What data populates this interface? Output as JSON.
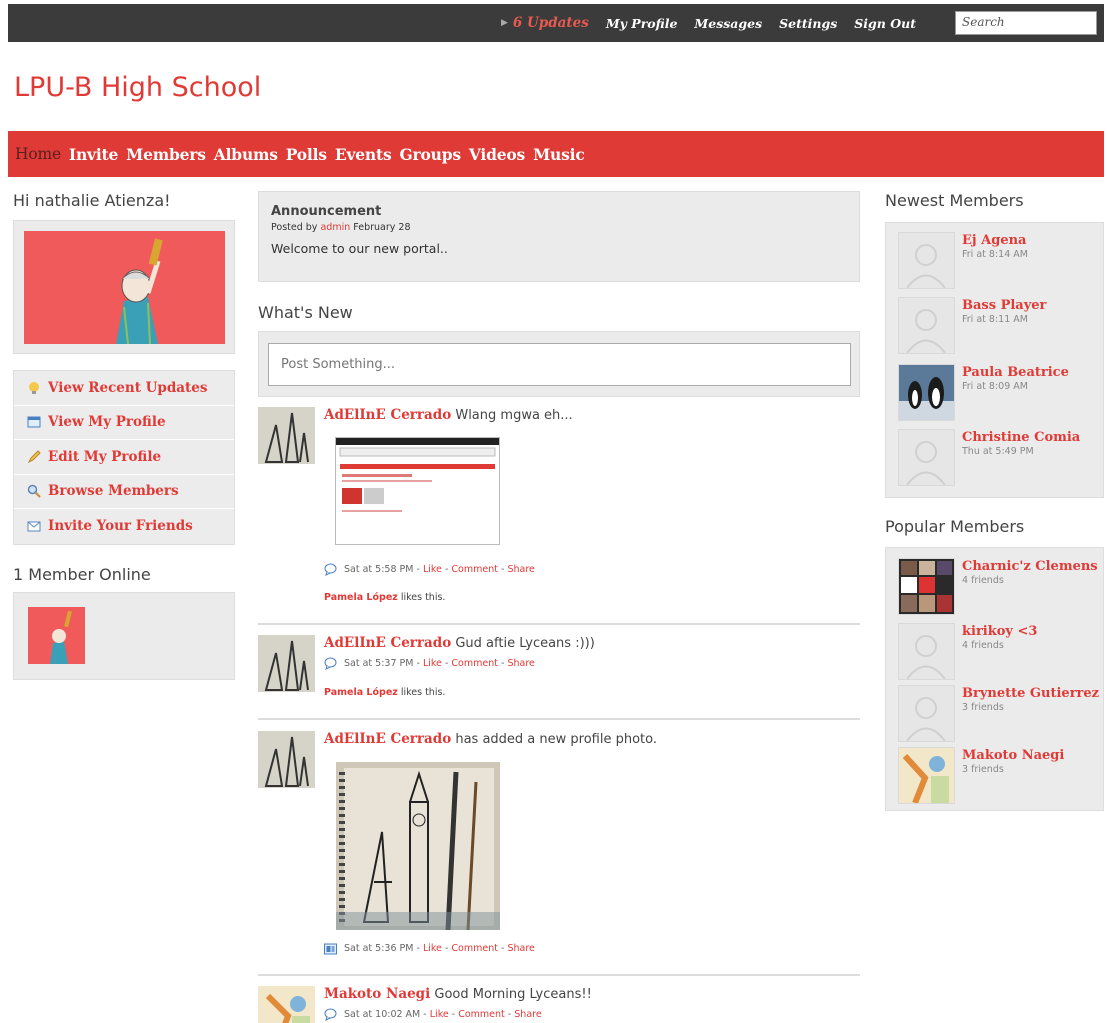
{
  "topbar": {
    "updates": "6 Updates",
    "links": [
      "My Profile",
      "Messages",
      "Settings",
      "Sign Out"
    ],
    "search_value": "Search"
  },
  "site_title": "LPU-B High School",
  "nav": [
    "Home",
    "Invite",
    "Members",
    "Albums",
    "Polls",
    "Events",
    "Groups",
    "Videos",
    "Music"
  ],
  "left": {
    "greeting": "Hi nathalie Atienza!",
    "quick_links": [
      {
        "label": "View Recent Updates",
        "icon": "lightbulb-icon"
      },
      {
        "label": "View My Profile",
        "icon": "profile-card-icon"
      },
      {
        "label": "Edit My Profile",
        "icon": "pencil-icon"
      },
      {
        "label": "Browse Members",
        "icon": "magnifier-icon"
      },
      {
        "label": "Invite Your Friends",
        "icon": "envelope-icon"
      }
    ],
    "online_title": "1 Member Online"
  },
  "announcement": {
    "title": "Announcement",
    "posted_by_prefix": "Posted by",
    "author": "admin",
    "date": "February 28",
    "message": "Welcome to our new portal.."
  },
  "whats_new": {
    "title": "What's New",
    "post_placeholder": "Post Something..."
  },
  "feed": [
    {
      "name": "AdElInE Cerrado",
      "text": "Wlang mgwa eh...",
      "time": "Sat at 5:58 PM",
      "likes_by": "Pamela López",
      "likes_suffix": "likes this."
    },
    {
      "name": "AdElInE Cerrado",
      "text": "Gud aftie Lyceans :)))",
      "time": "Sat at 5:37 PM",
      "likes_by": "Pamela López",
      "likes_suffix": "likes this."
    },
    {
      "name": "AdElInE Cerrado",
      "text": "has added a new profile photo.",
      "time": "Sat at 5:36 PM"
    },
    {
      "name": "Makoto Naegi",
      "text": "Good Morning Lyceans!!",
      "time": "Sat at 10:02 AM"
    }
  ],
  "actions": {
    "like": "Like",
    "comment": "Comment",
    "share": "Share",
    "sep": "-"
  },
  "newest_members": {
    "title": "Newest Members",
    "members": [
      {
        "name": "Ej Agena",
        "sub": "Fri at 8:14 AM"
      },
      {
        "name": "Bass Player",
        "sub": "Fri at 8:11 AM"
      },
      {
        "name": "Paula Beatrice",
        "sub": "Fri at 8:09 AM"
      },
      {
        "name": "Christine Comia",
        "sub": "Thu at 5:49 PM"
      }
    ]
  },
  "popular_members": {
    "title": "Popular Members",
    "members": [
      {
        "name": "Charnic'z Clemens",
        "sub": "4 friends"
      },
      {
        "name": "kirikoy <3",
        "sub": "4 friends"
      },
      {
        "name": "Brynette Gutierrez",
        "sub": "3 friends"
      },
      {
        "name": "Makoto Naegi",
        "sub": "3 friends"
      }
    ]
  },
  "colors": {
    "accent": "#e03a36",
    "topbar": "#3b3b3b",
    "panel": "#ebebeb"
  }
}
